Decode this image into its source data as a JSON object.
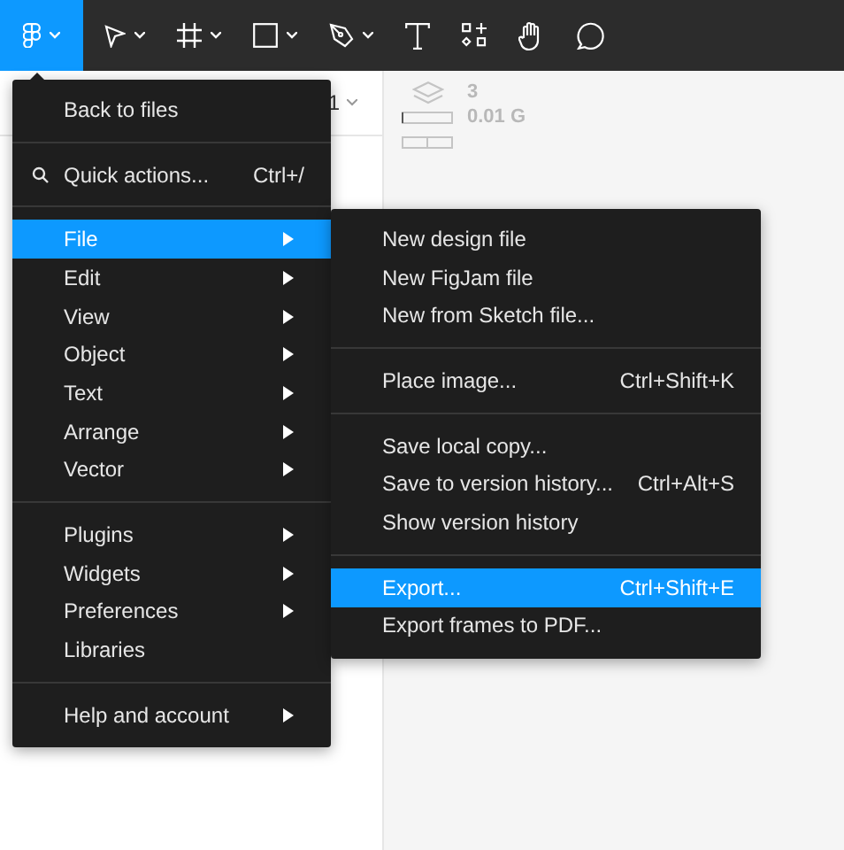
{
  "toolbar": {
    "main_menu_open": true
  },
  "left_panel": {
    "header_text": "1"
  },
  "right_panel": {
    "layer_count": "3",
    "size_text": "0.01 G"
  },
  "menu": {
    "sections": [
      {
        "items": [
          {
            "label": "Back to files",
            "kind": "plain",
            "selected": false
          }
        ]
      },
      {
        "items": [
          {
            "label": "Quick actions...",
            "kind": "search",
            "shortcut": "Ctrl+/",
            "selected": false
          }
        ]
      },
      {
        "items": [
          {
            "label": "File",
            "kind": "submenu",
            "selected": true
          },
          {
            "label": "Edit",
            "kind": "submenu",
            "selected": false
          },
          {
            "label": "View",
            "kind": "submenu",
            "selected": false
          },
          {
            "label": "Object",
            "kind": "submenu",
            "selected": false
          },
          {
            "label": "Text",
            "kind": "submenu",
            "selected": false
          },
          {
            "label": "Arrange",
            "kind": "submenu",
            "selected": false
          },
          {
            "label": "Vector",
            "kind": "submenu",
            "selected": false
          }
        ]
      },
      {
        "items": [
          {
            "label": "Plugins",
            "kind": "submenu",
            "selected": false
          },
          {
            "label": "Widgets",
            "kind": "submenu",
            "selected": false
          },
          {
            "label": "Preferences",
            "kind": "submenu",
            "selected": false
          },
          {
            "label": "Libraries",
            "kind": "plain",
            "selected": false
          }
        ]
      },
      {
        "items": [
          {
            "label": "Help and account",
            "kind": "submenu",
            "selected": false
          }
        ]
      }
    ]
  },
  "submenu": {
    "sections": [
      {
        "items": [
          {
            "label": "New design file",
            "kind": "plain",
            "selected": false
          },
          {
            "label": "New FigJam file",
            "kind": "plain",
            "selected": false
          },
          {
            "label": "New from Sketch file...",
            "kind": "plain",
            "selected": false
          }
        ]
      },
      {
        "items": [
          {
            "label": "Place image...",
            "kind": "plain",
            "shortcut": "Ctrl+Shift+K",
            "selected": false
          }
        ]
      },
      {
        "items": [
          {
            "label": "Save local copy...",
            "kind": "plain",
            "selected": false
          },
          {
            "label": "Save to version history...",
            "kind": "plain",
            "shortcut": "Ctrl+Alt+S",
            "selected": false
          },
          {
            "label": "Show version history",
            "kind": "plain",
            "selected": false
          }
        ]
      },
      {
        "items": [
          {
            "label": "Export...",
            "kind": "plain",
            "shortcut": "Ctrl+Shift+E",
            "selected": true
          },
          {
            "label": "Export frames to PDF...",
            "kind": "plain",
            "selected": false
          }
        ]
      }
    ]
  }
}
